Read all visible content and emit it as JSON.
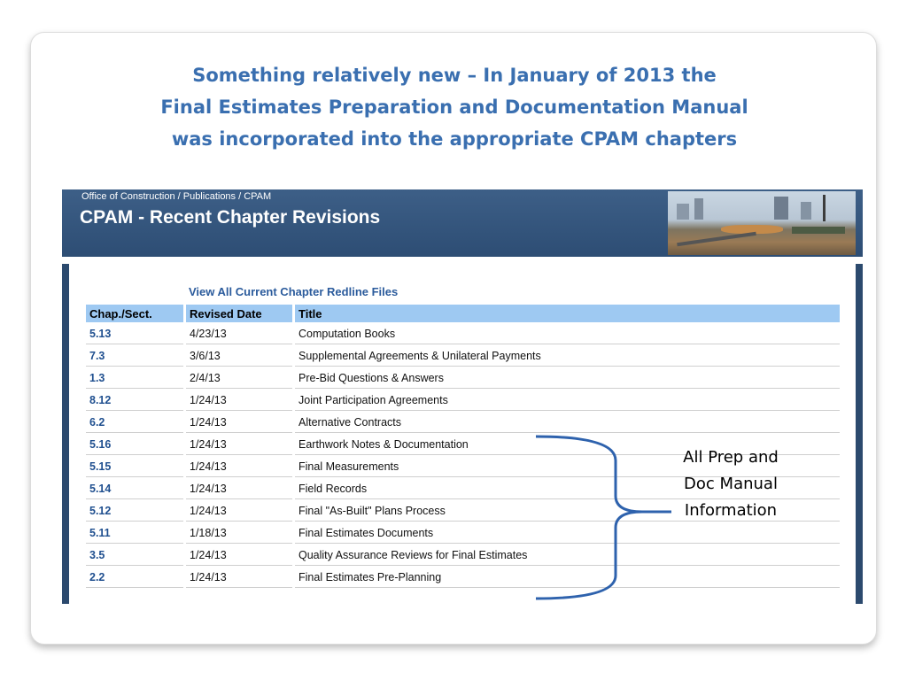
{
  "slide": {
    "title_lines": [
      "Something relatively new – In January of 2013 the",
      "Final Estimates Preparation and Documentation Manual",
      "was incorporated into the appropriate CPAM chapters"
    ],
    "annotation_lines": [
      "All Prep and",
      "Doc Manual",
      "Information"
    ]
  },
  "screenshot": {
    "breadcrumb": "Office of Construction / Publications / CPAM",
    "heading": "CPAM - Recent Chapter Revisions",
    "redline_link": "View All Current Chapter Redline Files",
    "columns": [
      "Chap./Sect.",
      "Revised Date",
      "Title"
    ],
    "rows": [
      [
        "5.13",
        "4/23/13",
        "Computation Books"
      ],
      [
        "7.3",
        "3/6/13",
        "Supplemental Agreements & Unilateral Payments"
      ],
      [
        "1.3",
        "2/4/13",
        "Pre-Bid Questions & Answers"
      ],
      [
        "8.12",
        "1/24/13",
        "Joint Participation Agreements"
      ],
      [
        "6.2",
        "1/24/13",
        "Alternative Contracts"
      ],
      [
        "5.16",
        "1/24/13",
        "Earthwork Notes & Documentation"
      ],
      [
        "5.15",
        "1/24/13",
        "Final Measurements"
      ],
      [
        "5.14",
        "1/24/13",
        "Field Records"
      ],
      [
        "5.12",
        "1/24/13",
        "Final \"As-Built\" Plans Process"
      ],
      [
        "5.11",
        "1/18/13",
        "Final Estimates Documents"
      ],
      [
        "3.5",
        "1/24/13",
        "Quality Assurance Reviews for Final Estimates"
      ],
      [
        "2.2",
        "1/24/13",
        "Final Estimates Pre-Planning"
      ]
    ]
  },
  "colors": {
    "title": "#3a6fb0",
    "header_bg": "#2d4d74",
    "table_header_bg": "#9ec9f2",
    "link": "#2b5b9c",
    "bracket": "#2e62ad"
  }
}
